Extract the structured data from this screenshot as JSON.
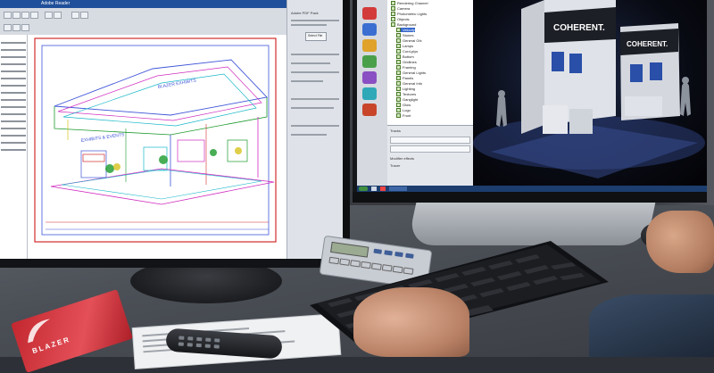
{
  "scene": {
    "description_free": true
  },
  "left_monitor": {
    "window_title": "Adobe Reader",
    "panel_heading": "Adobe PDF Pack",
    "panel_button_label": "Select File",
    "cad_sign_texts": [
      "BLAZER EXHIBITS",
      "EXHIBITS & EVENTS"
    ]
  },
  "right_monitor": {
    "tree_items": [
      "Rendering Channel",
      "Camera",
      "Photometric Lights",
      "Objects",
      "Background",
      "Velocity",
      "Stones",
      "General Gfx",
      "Lamps",
      "Cord-plys",
      "Bottom",
      "Gridlines",
      "Framing",
      "General Lights",
      "Panels",
      "General Info",
      "Lighting",
      "Textures",
      "Ganglight",
      "Glow",
      "Logo",
      "Front"
    ],
    "timeline_labels": [
      "Tracks",
      "Modifier effects",
      "Tracer"
    ],
    "exhibit_brand": "COHERENT."
  },
  "desk": {
    "business_card_brand": "BLAZER"
  },
  "colors": {
    "cad_green": "#1a9a2a",
    "cad_red": "#d22b2b",
    "cad_blue": "#3f55d8",
    "cad_magenta": "#d02cc0",
    "cad_cyan": "#18b7c8",
    "cad_yellow": "#d7c21c",
    "card_red": "#c3272f",
    "render_blue": "#1e2a4a"
  }
}
